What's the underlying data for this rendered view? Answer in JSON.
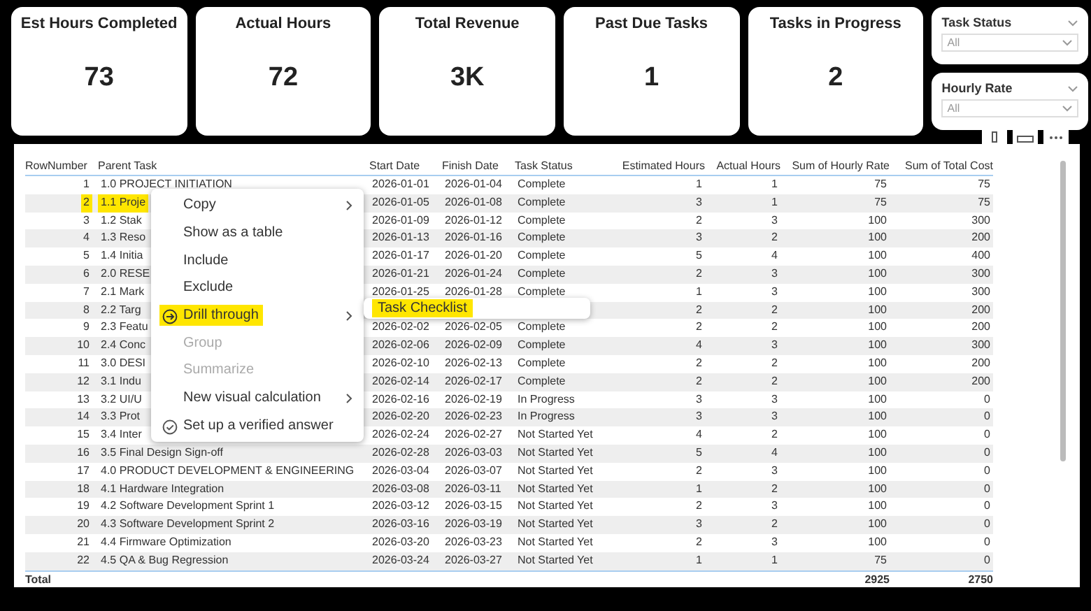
{
  "cards": [
    {
      "title": "Est Hours Completed",
      "value": "73"
    },
    {
      "title": "Actual Hours",
      "value": "72"
    },
    {
      "title": "Total Revenue",
      "value": "3K"
    },
    {
      "title": "Past Due Tasks",
      "value": "1"
    },
    {
      "title": "Tasks in Progress",
      "value": "2"
    }
  ],
  "slicers": [
    {
      "title": "Task Status",
      "value": "All"
    },
    {
      "title": "Hourly Rate",
      "value": "All"
    }
  ],
  "table": {
    "columns": [
      "RowNumber",
      "Parent Task",
      "Start Date",
      "Finish Date",
      "Task Status",
      "Estimated Hours",
      "Actual Hours",
      "Sum of Hourly Rate",
      "Sum of Total Cost"
    ],
    "rows": [
      {
        "cells": [
          "1",
          "1.0 PROJECT INITIATION",
          "2026-01-01",
          "2026-01-04",
          "Complete",
          "1",
          "1",
          "75",
          "75"
        ],
        "highlighted": false
      },
      {
        "cells": [
          "2",
          "1.1 Proje",
          "2026-01-05",
          "2026-01-08",
          "Complete",
          "3",
          "1",
          "75",
          "75"
        ],
        "highlighted": true
      },
      {
        "cells": [
          "3",
          "1.2 Stak",
          "2026-01-09",
          "2026-01-12",
          "Complete",
          "2",
          "3",
          "100",
          "300"
        ],
        "highlighted": false
      },
      {
        "cells": [
          "4",
          "1.3 Reso",
          "2026-01-13",
          "2026-01-16",
          "Complete",
          "3",
          "2",
          "100",
          "200"
        ],
        "highlighted": false
      },
      {
        "cells": [
          "5",
          "1.4 Initia",
          "2026-01-17",
          "2026-01-20",
          "Complete",
          "5",
          "4",
          "100",
          "400"
        ],
        "highlighted": false
      },
      {
        "cells": [
          "6",
          "2.0 RESE",
          "2026-01-21",
          "2026-01-24",
          "Complete",
          "2",
          "3",
          "100",
          "300"
        ],
        "highlighted": false
      },
      {
        "cells": [
          "7",
          "2.1 Mark",
          "2026-01-25",
          "2026-01-28",
          "Complete",
          "1",
          "3",
          "100",
          "300"
        ],
        "highlighted": false
      },
      {
        "cells": [
          "8",
          "2.2 Targ",
          null,
          null,
          null,
          "2",
          "2",
          "100",
          "200"
        ],
        "highlighted": false
      },
      {
        "cells": [
          "9",
          "2.3 Featu",
          "2026-02-02",
          "2026-02-05",
          "Complete",
          "2",
          "2",
          "100",
          "200"
        ],
        "highlighted": false
      },
      {
        "cells": [
          "10",
          "2.4 Conc",
          "2026-02-06",
          "2026-02-09",
          "Complete",
          "4",
          "3",
          "100",
          "300"
        ],
        "highlighted": false
      },
      {
        "cells": [
          "11",
          "3.0 DESI",
          "2026-02-10",
          "2026-02-13",
          "Complete",
          "2",
          "2",
          "100",
          "200"
        ],
        "highlighted": false
      },
      {
        "cells": [
          "12",
          "3.1 Indu",
          "2026-02-14",
          "2026-02-17",
          "Complete",
          "2",
          "2",
          "100",
          "200"
        ],
        "highlighted": false
      },
      {
        "cells": [
          "13",
          "3.2 UI/U",
          "2026-02-16",
          "2026-02-19",
          "In Progress",
          "3",
          "3",
          "100",
          "0"
        ],
        "highlighted": false
      },
      {
        "cells": [
          "14",
          "3.3 Prot",
          "2026-02-20",
          "2026-02-23",
          "In Progress",
          "3",
          "3",
          "100",
          "0"
        ],
        "highlighted": false
      },
      {
        "cells": [
          "15",
          "3.4 Inter",
          "2026-02-24",
          "2026-02-27",
          "Not Started Yet",
          "4",
          "2",
          "100",
          "0"
        ],
        "highlighted": false
      },
      {
        "cells": [
          "16",
          "3.5 Final Design Sign-off",
          "2026-02-28",
          "2026-03-03",
          "Not Started Yet",
          "5",
          "4",
          "100",
          "0"
        ],
        "highlighted": false
      },
      {
        "cells": [
          "17",
          "4.0 PRODUCT DEVELOPMENT & ENGINEERING",
          "2026-03-04",
          "2026-03-07",
          "Not Started Yet",
          "2",
          "3",
          "100",
          "0"
        ],
        "highlighted": false
      },
      {
        "cells": [
          "18",
          "4.1 Hardware Integration",
          "2026-03-08",
          "2026-03-11",
          "Not Started Yet",
          "1",
          "2",
          "100",
          "0"
        ],
        "highlighted": false
      },
      {
        "cells": [
          "19",
          "4.2 Software Development Sprint 1",
          "2026-03-12",
          "2026-03-15",
          "Not Started Yet",
          "2",
          "3",
          "100",
          "0"
        ],
        "highlighted": false
      },
      {
        "cells": [
          "20",
          "4.3 Software Development Sprint 2",
          "2026-03-16",
          "2026-03-19",
          "Not Started Yet",
          "3",
          "2",
          "100",
          "0"
        ],
        "highlighted": false
      },
      {
        "cells": [
          "21",
          "4.4 Firmware Optimization",
          "2026-03-20",
          "2026-03-23",
          "Not Started Yet",
          "2",
          "3",
          "100",
          "0"
        ],
        "highlighted": false
      },
      {
        "cells": [
          "22",
          "4.5 QA & Bug Regression",
          "2026-03-24",
          "2026-03-27",
          "Not Started Yet",
          "1",
          "1",
          "75",
          "0"
        ],
        "highlighted": false
      }
    ],
    "total": {
      "label": "Total",
      "cells": [
        null,
        null,
        null,
        null,
        null,
        null,
        "2925",
        "2750"
      ]
    }
  },
  "context_menu": {
    "items": [
      {
        "label": "Copy",
        "kind": "submenu",
        "disabled": false,
        "highlighted": false
      },
      {
        "label": "Show as a table",
        "kind": "plain",
        "disabled": false,
        "highlighted": false
      },
      {
        "label": "Include",
        "kind": "plain",
        "disabled": false,
        "highlighted": false
      },
      {
        "label": "Exclude",
        "kind": "plain",
        "disabled": false,
        "highlighted": false
      },
      {
        "label": "Drill through",
        "kind": "drill",
        "disabled": false,
        "highlighted": true
      },
      {
        "label": "Group",
        "kind": "plain",
        "disabled": true,
        "highlighted": false
      },
      {
        "label": "Summarize",
        "kind": "plain",
        "disabled": true,
        "highlighted": false
      },
      {
        "label": "New visual calculation",
        "kind": "submenu",
        "disabled": false,
        "highlighted": false
      },
      {
        "label": "Set up a verified answer",
        "kind": "verify",
        "disabled": false,
        "highlighted": false
      }
    ],
    "submenu": {
      "items": [
        {
          "label": "Task Checklist",
          "highlighted": true
        }
      ]
    }
  }
}
